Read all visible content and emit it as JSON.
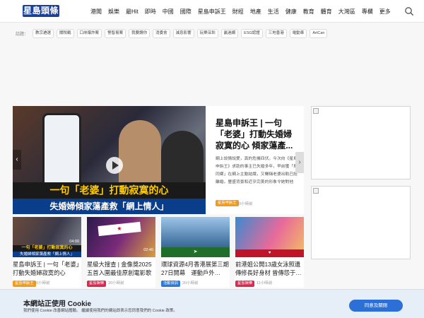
{
  "header": {
    "logo": "星島頭條",
    "nav": [
      "港聞",
      "娛樂",
      "最Hit",
      "即時",
      "中國",
      "國際",
      "星島申訴王",
      "財經",
      "地產",
      "生活",
      "健康",
      "教育",
      "體育",
      "大灣區",
      "專欄",
      "更多"
    ],
    "search_icon": "search-icon"
  },
  "tags": {
    "lead": "話題：",
    "items": [
      "教宗遴選",
      "關稅戰",
      "口岸爆炸案",
      "警智易案",
      "我要讚你",
      "消委會",
      "減息影響",
      "玩樂深圳",
      "贏過網",
      "ESG認證",
      "三地香港",
      "電動車",
      "ArtCan"
    ]
  },
  "hero": {
    "banner1": "一句「老婆」打動寂寞的心",
    "banner2": "失婚婦傾家蕩產救「網上情人」",
    "title": "星島申訴王 | 一句「老婆」打動失婚婦寂寞的心 傾家蕩產...",
    "desc": "網上談情說愛，真的危機四伏。今次向《星島申訴王》求助的事主已失婚多年，早前獲「男同鄉」在網上主動結識，又聲稱老婆出軌已經離婚。豐盛背景和近乎完美的形象令她對他",
    "badge": "星島申訴王",
    "time": "20小時前"
  },
  "cards": [
    {
      "title": "星島申訴王 | 一句「老婆」打動失婚婦寂寞的心",
      "badge": "星島申訴王",
      "badge_color": "#f39b1a",
      "time": "20小時前",
      "duration": "04:00"
    },
    {
      "title": "星級大搜查 | 金像獎2025五首入圍最佳原創電影歌曲",
      "badge": "星島娛樂",
      "badge_color": "#e0274d",
      "time": "20小時前",
      "duration": "02:46"
    },
    {
      "title": "環球資源4月香港展第三期27日開幕　運動戶外…",
      "badge": "活動資訊",
      "badge_color": "#2d7ad6",
      "time": "20小時前",
      "duration": ""
    },
    {
      "title": "前港姐公開13歲女泳照遺傳修長好身材 曾傳怨于…",
      "badge": "星島娛樂",
      "badge_color": "#e0274d",
      "time": "11小時前",
      "duration": ""
    }
  ],
  "cookie": {
    "title": "本網站正使用 Cookie",
    "text": "我們使用 Cookie 改善網站體驗。 繼續使用我們的網站即表示您同意我們的 Cookie 政策。",
    "button": "同意及關閉"
  },
  "colors": {
    "brand": "#1b3f9a",
    "accent_button": "#2c6fd6",
    "cookie_bg": "#e6eef8"
  }
}
